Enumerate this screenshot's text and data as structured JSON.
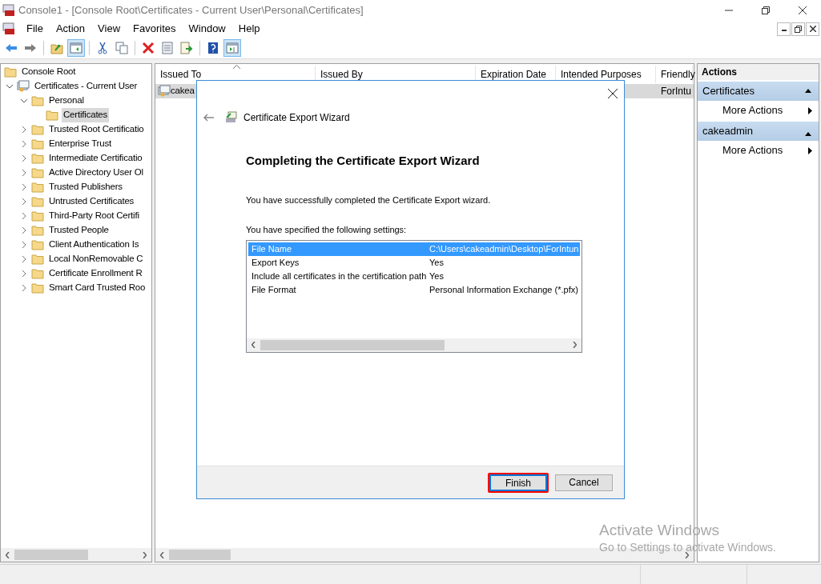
{
  "window": {
    "title": "Console1 - [Console Root\\Certificates - Current User\\Personal\\Certificates]"
  },
  "menu": [
    "File",
    "Action",
    "View",
    "Favorites",
    "Window",
    "Help"
  ],
  "toolbar": [
    {
      "kind": "back",
      "pressed": false
    },
    {
      "kind": "forward",
      "pressed": false
    },
    {
      "kind": "sep"
    },
    {
      "kind": "up",
      "pressed": false
    },
    {
      "kind": "pane",
      "pressed": true
    },
    {
      "kind": "sep"
    },
    {
      "kind": "cut",
      "pressed": false
    },
    {
      "kind": "copy",
      "pressed": false
    },
    {
      "kind": "sep"
    },
    {
      "kind": "delete",
      "pressed": false
    },
    {
      "kind": "properties",
      "pressed": false
    },
    {
      "kind": "export",
      "pressed": false
    },
    {
      "kind": "sep"
    },
    {
      "kind": "help",
      "pressed": false
    },
    {
      "kind": "actionpane",
      "pressed": true
    }
  ],
  "tree": [
    {
      "label": "Console Root",
      "kind": "folder",
      "selected": false,
      "children": [
        {
          "label": "Certificates - Current User",
          "kind": "certstore",
          "expanded": true,
          "selected": false,
          "children": [
            {
              "label": "Personal",
              "kind": "folder",
              "expanded": true,
              "selected": false,
              "children": [
                {
                  "label": "Certificates",
                  "kind": "folder",
                  "selected": true
                }
              ]
            },
            {
              "label": "Trusted Root Certificatio",
              "kind": "folder",
              "expanded": false,
              "selected": false
            },
            {
              "label": "Enterprise Trust",
              "kind": "folder",
              "expanded": false,
              "selected": false
            },
            {
              "label": "Intermediate Certificatio",
              "kind": "folder",
              "expanded": false,
              "selected": false
            },
            {
              "label": "Active Directory User Ol",
              "kind": "folder",
              "expanded": false,
              "selected": false
            },
            {
              "label": "Trusted Publishers",
              "kind": "folder",
              "expanded": false,
              "selected": false
            },
            {
              "label": "Untrusted Certificates",
              "kind": "folder",
              "expanded": false,
              "selected": false
            },
            {
              "label": "Third-Party Root Certifi",
              "kind": "folder",
              "expanded": false,
              "selected": false
            },
            {
              "label": "Trusted People",
              "kind": "folder",
              "expanded": false,
              "selected": false
            },
            {
              "label": "Client Authentication Is",
              "kind": "folder",
              "expanded": false,
              "selected": false
            },
            {
              "label": "Local NonRemovable C",
              "kind": "folder",
              "expanded": false,
              "selected": false
            },
            {
              "label": "Certificate Enrollment R",
              "kind": "folder",
              "expanded": false,
              "selected": false
            },
            {
              "label": "Smart Card Trusted Roo",
              "kind": "folder",
              "expanded": false,
              "selected": false
            }
          ]
        }
      ]
    }
  ],
  "table": {
    "columns": [
      "Issued To",
      "Issued By",
      "Expiration Date",
      "Intended Purposes",
      "Friendly"
    ],
    "rows": [
      {
        "issued_to": "cakea",
        "friendly_name": "ForIntu"
      }
    ]
  },
  "actions": {
    "title": "Actions",
    "groups": [
      {
        "title": "Certificates",
        "items": [
          "More Actions"
        ]
      },
      {
        "title": "cakeadmin",
        "items": [
          "More Actions"
        ]
      }
    ]
  },
  "dialog": {
    "title": "Certificate Export Wizard",
    "heading": "Completing the Certificate Export Wizard",
    "message": "You have successfully completed the Certificate Export wizard.",
    "settings_label": "You have specified the following settings:",
    "settings": [
      {
        "name": "File Name",
        "value": "C:\\Users\\cakeadmin\\Desktop\\ForIntun",
        "selected": true
      },
      {
        "name": "Export Keys",
        "value": "Yes",
        "selected": false
      },
      {
        "name": "Include all certificates in the certification path",
        "value": "Yes",
        "selected": false
      },
      {
        "name": "File Format",
        "value": "Personal Information Exchange (*.pfx)",
        "selected": false
      }
    ],
    "buttons": [
      {
        "label": "Finish",
        "default": true,
        "highlighted": true
      },
      {
        "label": "Cancel",
        "default": false,
        "highlighted": false
      }
    ]
  },
  "activation": {
    "title": "Activate Windows",
    "message": "Go to Settings to activate Windows."
  }
}
